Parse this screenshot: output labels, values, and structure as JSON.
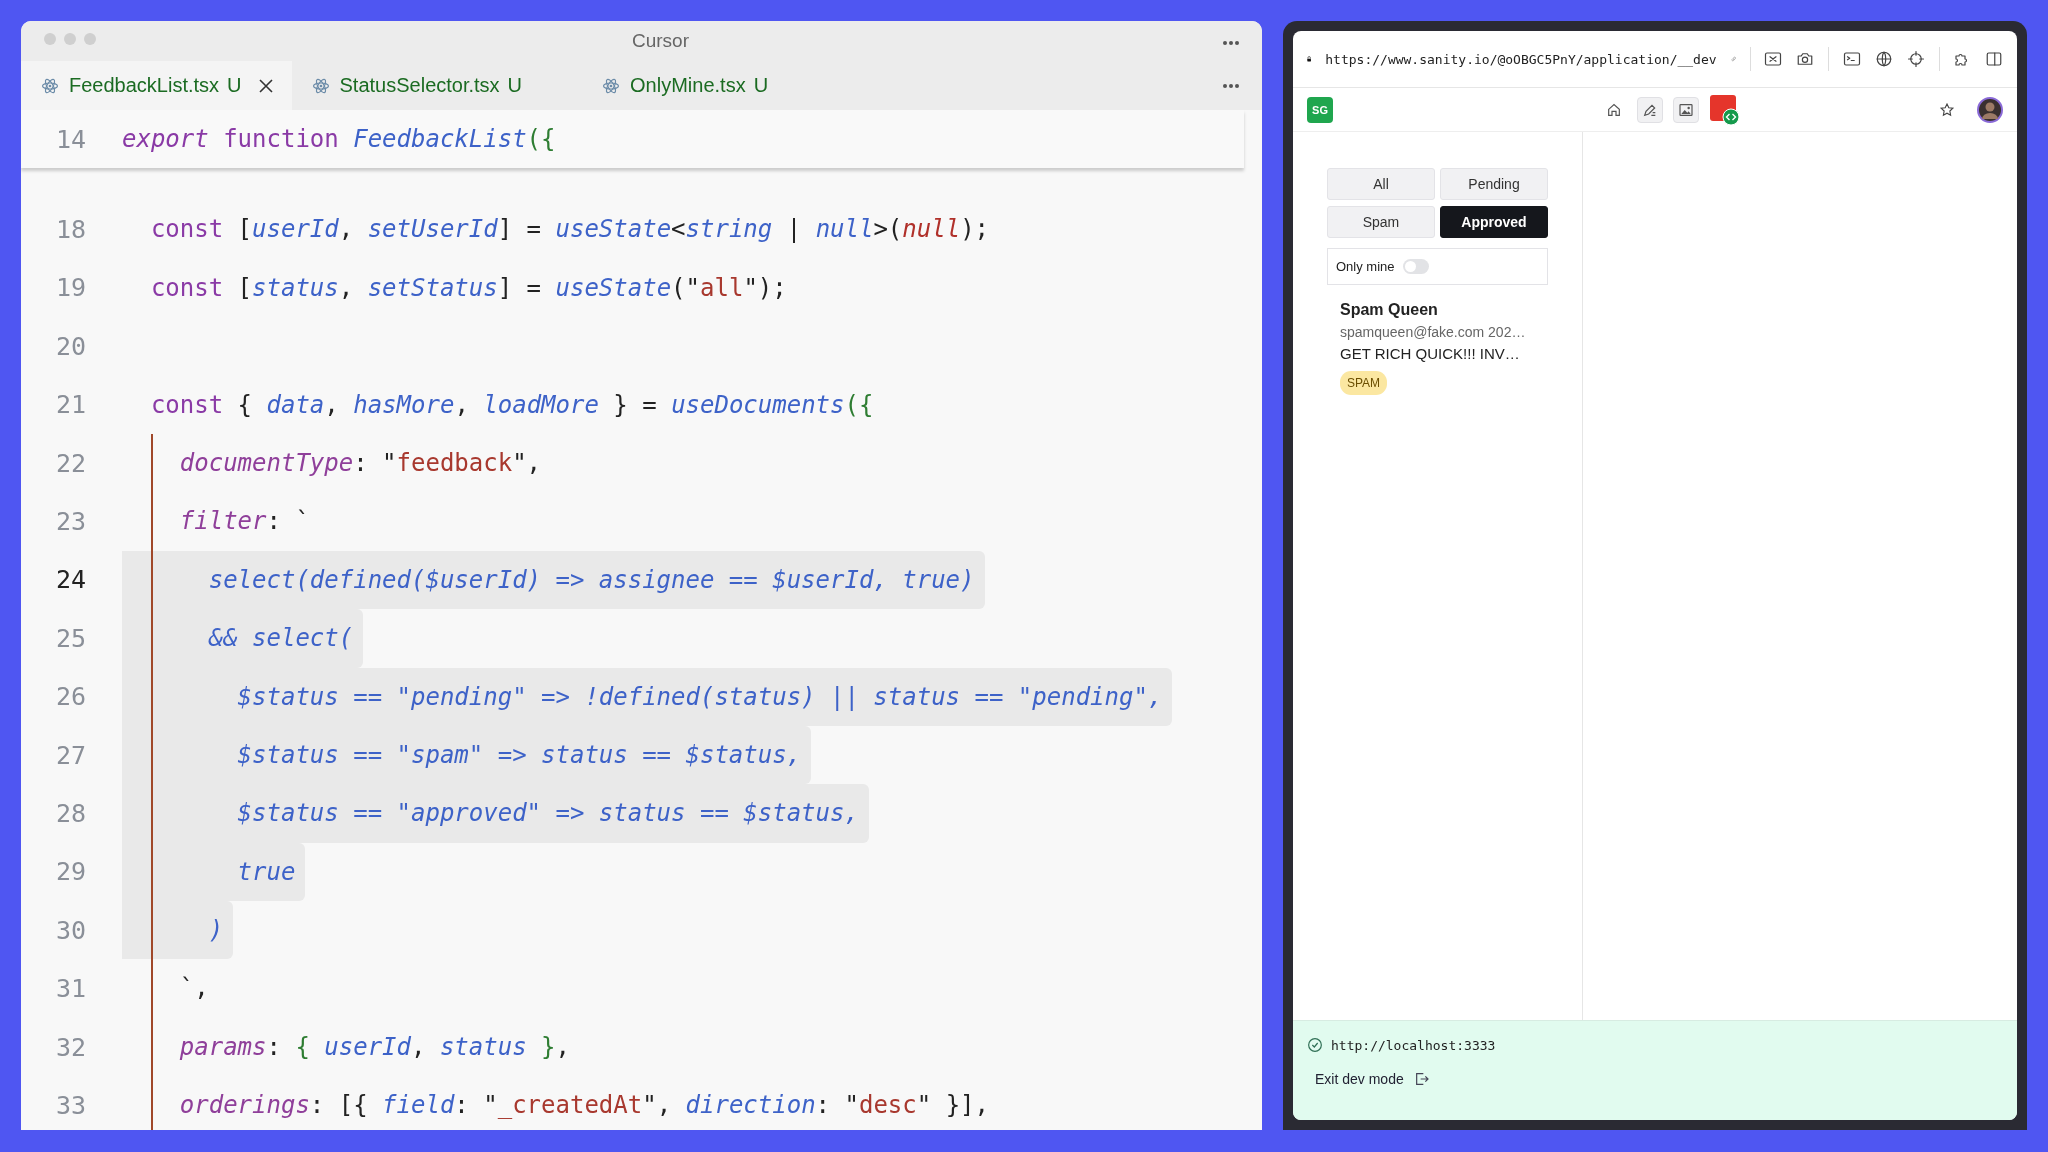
{
  "editor": {
    "title": "Cursor",
    "tabs": [
      {
        "label": "FeedbackList.tsx",
        "status": "U",
        "selected": true
      },
      {
        "label": "StatusSelector.tsx",
        "status": "U",
        "selected": false
      },
      {
        "label": "OnlyMine.tsx",
        "status": "U",
        "selected": false
      }
    ],
    "sticky_line": {
      "number": "14",
      "tokens": [
        {
          "kind": "modifier",
          "text": "export"
        },
        {
          "kind": "keyword",
          "text": " function"
        },
        {
          "kind": "identifier",
          "text": " FeedbackList"
        },
        {
          "kind": "bracket",
          "text": "({"
        }
      ]
    },
    "lines": [
      {
        "number": "18",
        "current": false,
        "highlighted": false,
        "scope": false,
        "tokens": [
          {
            "kind": "keyword",
            "text": "  const"
          },
          {
            "kind": "plain",
            "text": " ["
          },
          {
            "kind": "identifier",
            "text": "userId"
          },
          {
            "kind": "plain",
            "text": ", "
          },
          {
            "kind": "identifier",
            "text": "setUserId"
          },
          {
            "kind": "plain",
            "text": "] = "
          },
          {
            "kind": "identifier",
            "text": "useState"
          },
          {
            "kind": "plain",
            "text": "<"
          },
          {
            "kind": "identifier",
            "text": "string"
          },
          {
            "kind": "plain",
            "text": " | "
          },
          {
            "kind": "identifier",
            "text": "null"
          },
          {
            "kind": "plain",
            "text": ">("
          },
          {
            "kind": "literal",
            "text": "null"
          },
          {
            "kind": "plain",
            "text": ");"
          }
        ]
      },
      {
        "number": "19",
        "current": false,
        "highlighted": false,
        "scope": false,
        "tokens": [
          {
            "kind": "keyword",
            "text": "  const"
          },
          {
            "kind": "plain",
            "text": " ["
          },
          {
            "kind": "identifier",
            "text": "status"
          },
          {
            "kind": "plain",
            "text": ", "
          },
          {
            "kind": "identifier",
            "text": "setStatus"
          },
          {
            "kind": "plain",
            "text": "] = "
          },
          {
            "kind": "identifier",
            "text": "useState"
          },
          {
            "kind": "plain",
            "text": "(\""
          },
          {
            "kind": "string",
            "text": "all"
          },
          {
            "kind": "plain",
            "text": "\");"
          }
        ]
      },
      {
        "number": "20",
        "current": false
      },
      {
        "number": "21",
        "current": false,
        "highlighted": false,
        "scope": false,
        "tokens": [
          {
            "kind": "keyword",
            "text": "  const"
          },
          {
            "kind": "plain",
            "text": " { "
          },
          {
            "kind": "identifier",
            "text": "data"
          },
          {
            "kind": "plain",
            "text": ", "
          },
          {
            "kind": "identifier",
            "text": "hasMore"
          },
          {
            "kind": "plain",
            "text": ", "
          },
          {
            "kind": "identifier",
            "text": "loadMore"
          },
          {
            "kind": "plain",
            "text": " } = "
          },
          {
            "kind": "identifier",
            "text": "useDocuments"
          },
          {
            "kind": "bracket",
            "text": "({"
          }
        ]
      },
      {
        "number": "22",
        "current": false,
        "highlighted": false,
        "scope": true,
        "tokens": [
          {
            "kind": "property",
            "text": "    documentType"
          },
          {
            "kind": "plain",
            "text": ": \""
          },
          {
            "kind": "string",
            "text": "feedback"
          },
          {
            "kind": "plain",
            "text": "\","
          }
        ]
      },
      {
        "number": "23",
        "current": false,
        "highlighted": false,
        "scope": true,
        "tokens": [
          {
            "kind": "property",
            "text": "    filter"
          },
          {
            "kind": "plain",
            "text": ": `"
          }
        ]
      },
      {
        "number": "24",
        "current": true,
        "highlighted": true,
        "scope": true,
        "tokens": [
          {
            "kind": "identifier",
            "text": "      select(defined($userId) => assignee == $userId, true)"
          }
        ]
      },
      {
        "number": "25",
        "current": false,
        "highlighted": true,
        "scope": true,
        "tokens": [
          {
            "kind": "identifier",
            "text": "      && select("
          }
        ]
      },
      {
        "number": "26",
        "current": false,
        "highlighted": true,
        "scope": true,
        "tokens": [
          {
            "kind": "identifier",
            "text": "        $status == \"pending\" => !defined(status) || status == \"pending\","
          }
        ]
      },
      {
        "number": "27",
        "current": false,
        "highlighted": true,
        "scope": true,
        "tokens": [
          {
            "kind": "identifier",
            "text": "        $status == \"spam\" => status == $status,"
          }
        ]
      },
      {
        "number": "28",
        "current": false,
        "highlighted": true,
        "scope": true,
        "tokens": [
          {
            "kind": "identifier",
            "text": "        $status == \"approved\" => status == $status,"
          }
        ]
      },
      {
        "number": "29",
        "current": false,
        "highlighted": true,
        "scope": true,
        "tokens": [
          {
            "kind": "identifier",
            "text": "        true"
          }
        ]
      },
      {
        "number": "30",
        "current": false,
        "highlighted": true,
        "scope": true,
        "tokens": [
          {
            "kind": "identifier",
            "text": "      )"
          }
        ]
      },
      {
        "number": "31",
        "current": false,
        "highlighted": false,
        "scope": true,
        "tokens": [
          {
            "kind": "plain",
            "text": "    `,"
          }
        ]
      },
      {
        "number": "32",
        "current": false,
        "highlighted": false,
        "scope": true,
        "tokens": [
          {
            "kind": "property",
            "text": "    params"
          },
          {
            "kind": "plain",
            "text": ": "
          },
          {
            "kind": "bracket",
            "text": "{"
          },
          {
            "kind": "identifier",
            "text": " userId"
          },
          {
            "kind": "plain",
            "text": ", "
          },
          {
            "kind": "identifier",
            "text": "status"
          },
          {
            "kind": "bracket",
            "text": " }"
          },
          {
            "kind": "plain",
            "text": ","
          }
        ]
      },
      {
        "number": "33",
        "current": false,
        "highlighted": false,
        "scope": true,
        "tokens": [
          {
            "kind": "property",
            "text": "    orderings"
          },
          {
            "kind": "plain",
            "text": ": [{ "
          },
          {
            "kind": "identifier",
            "text": "field"
          },
          {
            "kind": "plain",
            "text": ": \""
          },
          {
            "kind": "string",
            "text": "_createdAt"
          },
          {
            "kind": "plain",
            "text": "\", "
          },
          {
            "kind": "identifier",
            "text": "direction"
          },
          {
            "kind": "plain",
            "text": ": \""
          },
          {
            "kind": "string",
            "text": "desc"
          },
          {
            "kind": "plain",
            "text": "\" }],"
          }
        ]
      }
    ]
  },
  "browser": {
    "url": "https://www.sanity.io/@oOBGC5PnY/application/__dev",
    "workspace_badge": "SG",
    "filters": [
      {
        "label": "All",
        "selected": false
      },
      {
        "label": "Pending",
        "selected": false
      },
      {
        "label": "Spam",
        "selected": false
      },
      {
        "label": "Approved",
        "selected": true
      }
    ],
    "only_mine": {
      "label": "Only mine",
      "on": false
    },
    "items": [
      {
        "title": "Spam Queen",
        "meta": "spamqueen@fake.com 202…",
        "excerpt": "GET RICH QUICK!!! INV…",
        "tag": "SPAM"
      }
    ],
    "dev_server": {
      "url": "http://localhost:3333",
      "exit_label": "Exit dev mode"
    }
  }
}
